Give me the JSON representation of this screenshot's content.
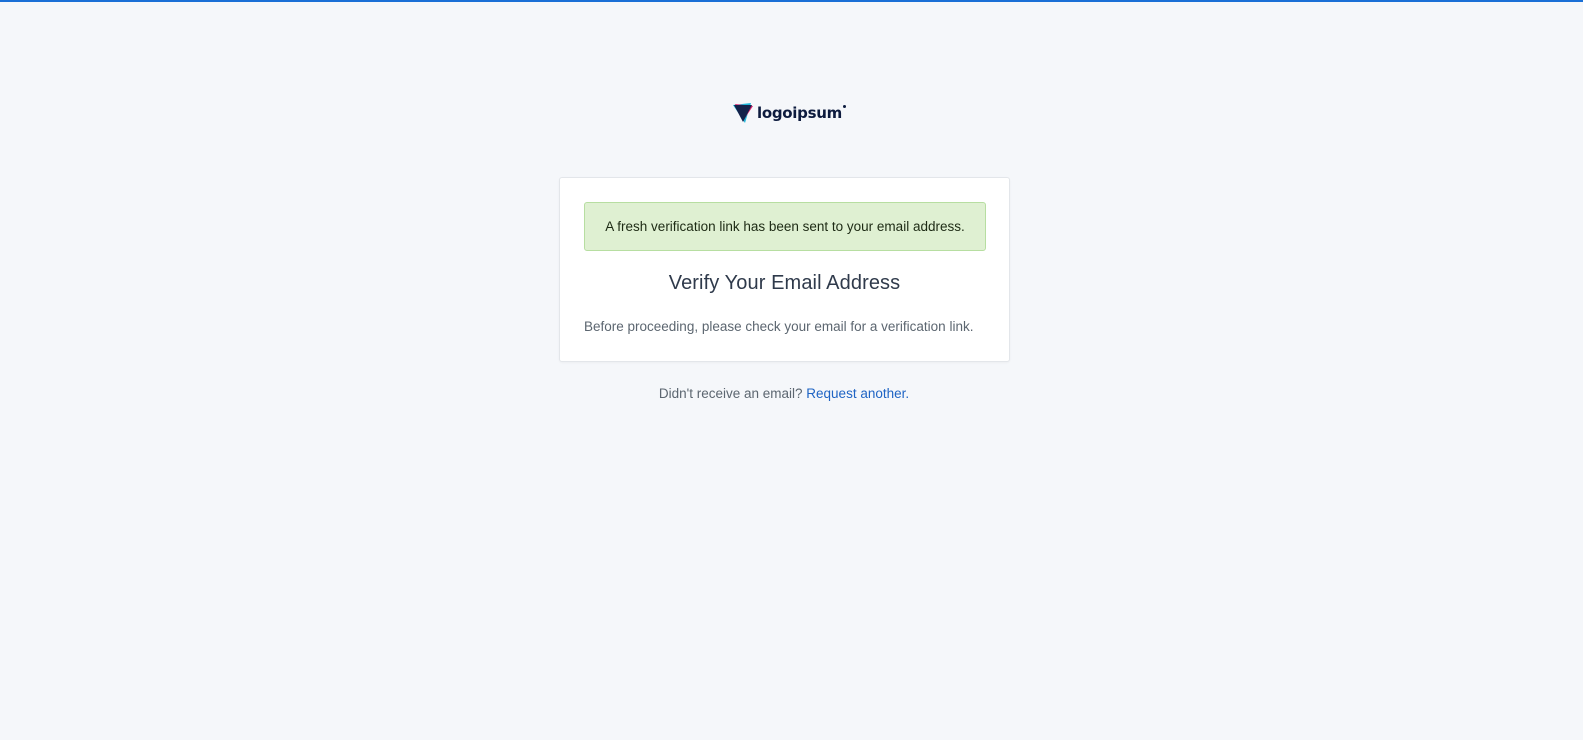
{
  "brand": {
    "name": "logoipsum",
    "accent_color": "#1a6fd6",
    "logo_icon": "triangle-shield-logo-icon"
  },
  "alert": {
    "message": "A fresh verification link has been sent to your email address.",
    "color": "#dff0d2"
  },
  "card": {
    "title": "Verify Your Email Address",
    "body": "Before proceeding, please check your email for a verification link."
  },
  "footer": {
    "prompt": "Didn't receive an email?",
    "link_label": "Request another",
    "suffix": "."
  }
}
